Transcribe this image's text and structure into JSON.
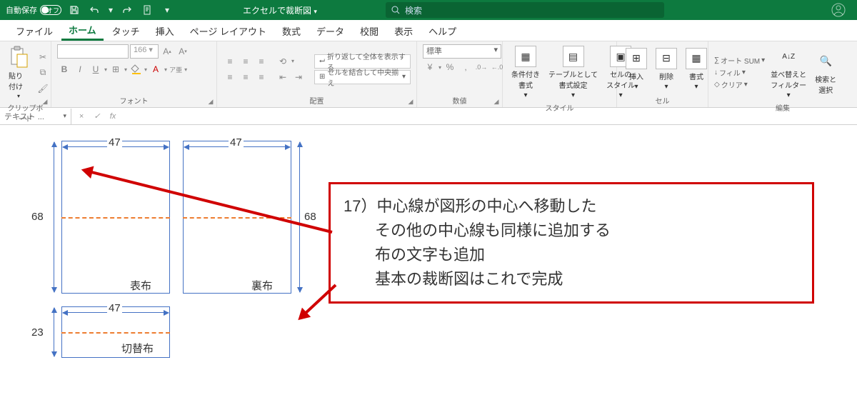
{
  "title": {
    "autosave": "自動保存",
    "autosave_state": "オフ",
    "doc": "エクセルで裁断図",
    "search_ph": "検索"
  },
  "tabs": [
    "ファイル",
    "ホーム",
    "タッチ",
    "挿入",
    "ページ レイアウト",
    "数式",
    "データ",
    "校閲",
    "表示",
    "ヘルプ"
  ],
  "active_tab": 1,
  "ribbon": {
    "clipboard": {
      "paste": "貼り付け",
      "label": "クリップボード"
    },
    "font": {
      "size": "166",
      "label": "フォント"
    },
    "align": {
      "wrap": "折り返して全体を表示する",
      "merge": "セルを結合して中央揃え",
      "label": "配置"
    },
    "number": {
      "fmt": "標準",
      "label": "数値"
    },
    "style": {
      "cond": "条件付き\n書式",
      "table": "テーブルとして\n書式設定",
      "cell": "セルの\nスタイル",
      "label": "スタイル"
    },
    "cells": {
      "insert": "挿入",
      "delete": "削除",
      "format": "書式",
      "label": "セル"
    },
    "edit": {
      "sum": "オート SUM",
      "fill": "フィル",
      "clear": "クリア",
      "sort": "並べ替えと\nフィルター",
      "find": "検索と\n選択",
      "label": "編集"
    }
  },
  "namebox": "テキスト ...",
  "diagram": {
    "w": "47",
    "h": "68",
    "w2": "47",
    "h2": "68",
    "w3": "47",
    "h3": "23",
    "label1": "表布",
    "label2": "裏布",
    "label3": "切替布"
  },
  "callout": {
    "l1": "17）中心線が図形の中心へ移動した",
    "l2": "　　その他の中心線も同様に追加する",
    "l3": "　　布の文字も追加",
    "l4": "　　基本の裁断図はこれで完成"
  }
}
